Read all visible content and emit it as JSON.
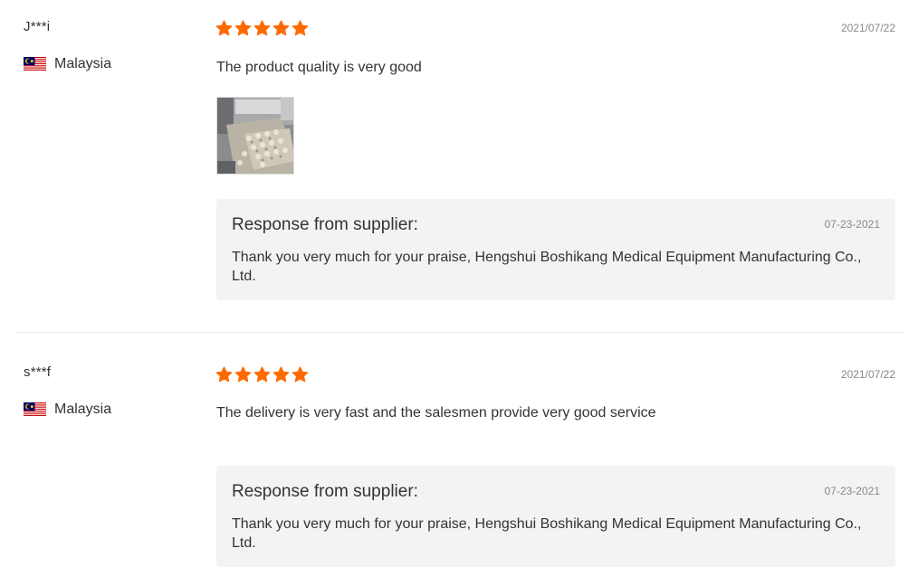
{
  "colors": {
    "star": "#ff6a00",
    "response_bg": "#f3f3f3",
    "text": "#333333",
    "muted": "#888888"
  },
  "icons": {
    "star": "star-icon",
    "flag": "malaysia-flag-icon"
  },
  "reviews": [
    {
      "user": "J***i",
      "country": "Malaysia",
      "rating": 5,
      "date": "2021/07/22",
      "text": "The product quality is very good",
      "response": {
        "title": "Response from supplier:",
        "date": "07-23-2021",
        "text": "Thank you very much for your praise, Hengshui Boshikang Medical Equipment Manufacturing Co., Ltd."
      }
    },
    {
      "user": "s***f",
      "country": "Malaysia",
      "rating": 5,
      "date": "2021/07/22",
      "text": "The delivery is very fast and the salesmen provide very good service",
      "response": {
        "title": "Response from supplier:",
        "date": "07-23-2021",
        "text": "Thank you very much for your praise, Hengshui Boshikang Medical Equipment Manufacturing Co., Ltd."
      }
    }
  ]
}
